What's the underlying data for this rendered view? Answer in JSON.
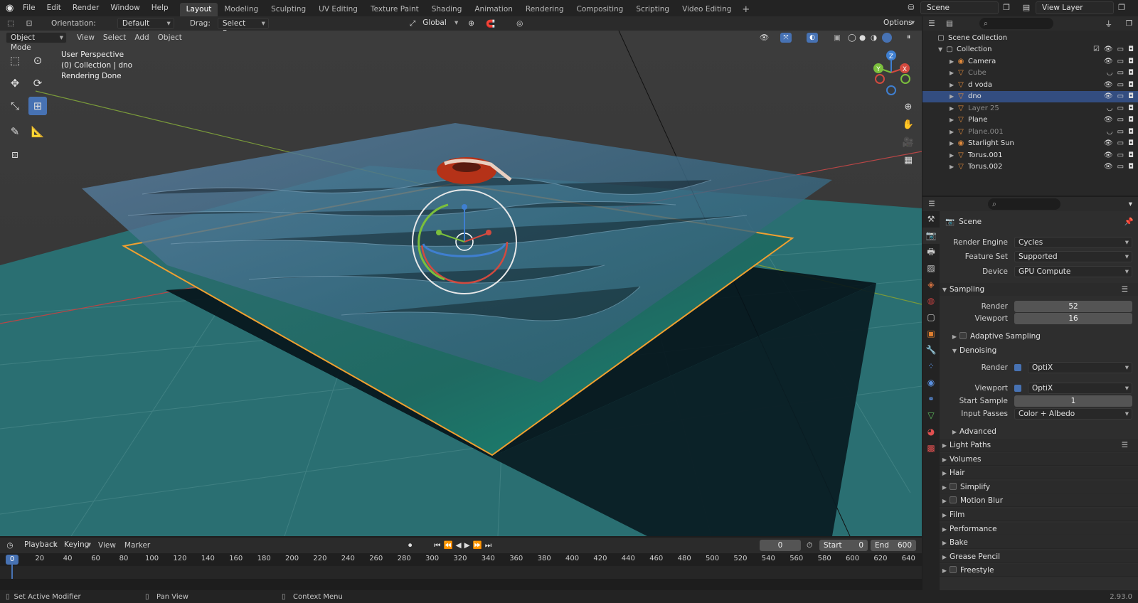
{
  "menu": {
    "items": [
      "File",
      "Edit",
      "Render",
      "Window",
      "Help"
    ]
  },
  "workspaces": {
    "tabs": [
      "Layout",
      "Modeling",
      "Sculpting",
      "UV Editing",
      "Texture Paint",
      "Shading",
      "Animation",
      "Rendering",
      "Compositing",
      "Scripting",
      "Video Editing"
    ],
    "active": "Layout"
  },
  "scene": {
    "name": "Scene"
  },
  "view_layer": {
    "name": "View Layer"
  },
  "vp_header": {
    "mode": "Object Mode",
    "menus": [
      "View",
      "Select",
      "Add",
      "Object"
    ],
    "orientation_label": "Orientation:",
    "orientation_value": "Default",
    "drag_label": "Drag:",
    "drag_value": "Select Box",
    "transform_space": "Global",
    "options": "Options"
  },
  "viewport": {
    "info_line1": "User Perspective",
    "info_line2": "(0) Collection | dno",
    "info_line3": "Rendering Done",
    "gizmo": {
      "x": "X",
      "y": "Y",
      "z": "Z"
    }
  },
  "timeline": {
    "menus": [
      "Playback",
      "Keying",
      "View",
      "Marker"
    ],
    "current_frame": "0",
    "start_label": "Start",
    "start_value": "0",
    "end_label": "End",
    "end_value": "600",
    "ticks": [
      "0",
      "20",
      "40",
      "60",
      "80",
      "100",
      "120",
      "140",
      "160",
      "180",
      "200",
      "220",
      "240",
      "260",
      "280",
      "300",
      "320",
      "340",
      "360",
      "380",
      "400",
      "420",
      "440",
      "460",
      "480",
      "500",
      "520",
      "540",
      "560",
      "580",
      "600",
      "620",
      "640"
    ]
  },
  "status": {
    "left": "Set Active Modifier",
    "mid": "Pan View",
    "right": "Context Menu",
    "version": "2.93.0"
  },
  "outliner": {
    "root": "Scene Collection",
    "collection": "Collection",
    "items": [
      {
        "name": "Camera",
        "dim": false,
        "selected": false
      },
      {
        "name": "Cube",
        "dim": true,
        "selected": false
      },
      {
        "name": "d voda",
        "dim": false,
        "selected": false
      },
      {
        "name": "dno",
        "dim": false,
        "selected": true
      },
      {
        "name": "Layer 25",
        "dim": true,
        "selected": false
      },
      {
        "name": "Plane",
        "dim": false,
        "selected": false
      },
      {
        "name": "Plane.001",
        "dim": true,
        "selected": false
      },
      {
        "name": "Starlight Sun",
        "dim": false,
        "selected": false
      },
      {
        "name": "Torus.001",
        "dim": false,
        "selected": false
      },
      {
        "name": "Torus.002",
        "dim": false,
        "selected": false
      }
    ]
  },
  "properties": {
    "context": "Scene",
    "render_engine_label": "Render Engine",
    "render_engine": "Cycles",
    "feature_set_label": "Feature Set",
    "feature_set": "Supported",
    "device_label": "Device",
    "device": "GPU Compute",
    "sampling": "Sampling",
    "render_label": "Render",
    "render_samples": "52",
    "viewport_label": "Viewport",
    "viewport_samples": "16",
    "adaptive_sampling": "Adaptive Sampling",
    "denoising": "Denoising",
    "denoise_render_label": "Render",
    "denoise_render": "OptiX",
    "denoise_viewport_label": "Viewport",
    "denoise_viewport": "OptiX",
    "start_sample_label": "Start Sample",
    "start_sample": "1",
    "input_passes_label": "Input Passes",
    "input_passes": "Color + Albedo",
    "advanced": "Advanced",
    "panels": [
      "Light Paths",
      "Volumes",
      "Hair",
      "Simplify",
      "Motion Blur",
      "Film",
      "Performance",
      "Bake",
      "Grease Pencil",
      "Freestyle"
    ]
  }
}
